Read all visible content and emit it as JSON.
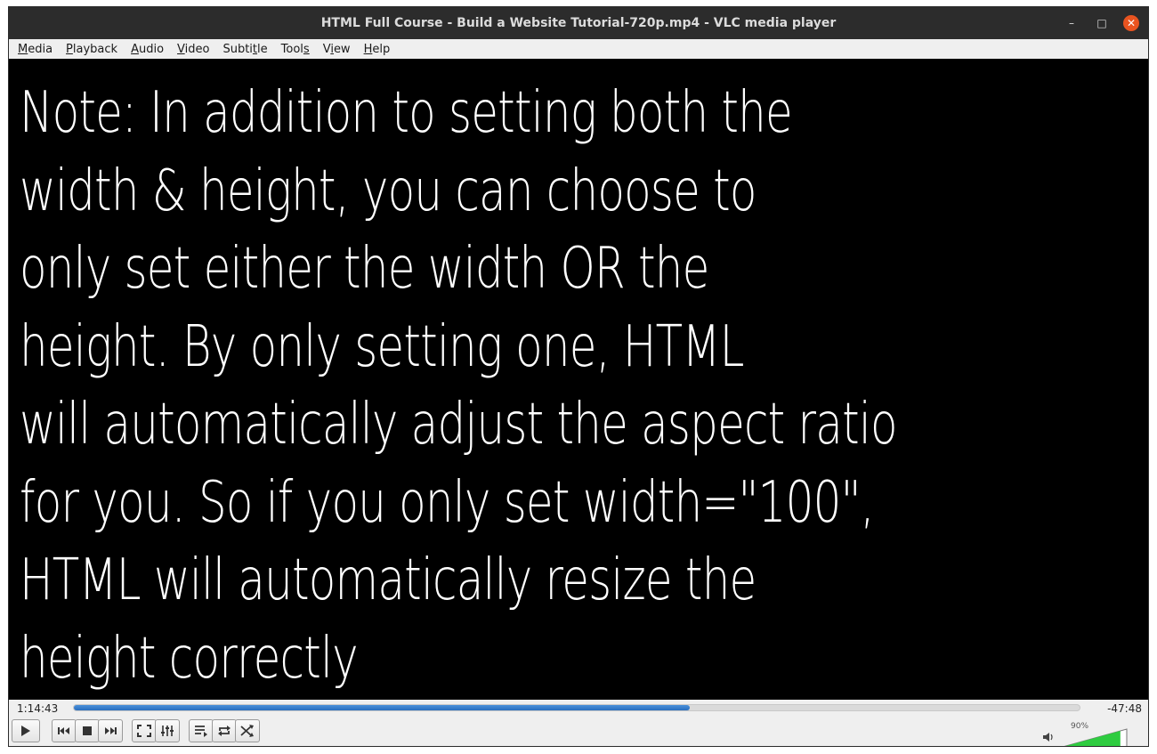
{
  "window": {
    "title": "HTML Full Course - Build a Website Tutorial-720p.mp4 - VLC media player",
    "minimize_glyph": "–",
    "maximize_glyph": "□",
    "close_glyph": "✕"
  },
  "menu": [
    {
      "u": "M",
      "rest": "edia"
    },
    {
      "u": "P",
      "rest": "layback"
    },
    {
      "u": "A",
      "rest": "udio"
    },
    {
      "u": "V",
      "rest": "ideo"
    },
    {
      "u": "",
      "pre": "Subti",
      "u2": "t",
      "rest": "le"
    },
    {
      "u": "",
      "pre": "Tool",
      "u2": "s",
      "rest": ""
    },
    {
      "u": "",
      "pre": "V",
      "u2": "i",
      "rest": "ew"
    },
    {
      "u": "H",
      "rest": "elp"
    }
  ],
  "video": {
    "lines": [
      "Note: In addition to setting both the",
      "width & height, you can choose to",
      "only set either the width OR the",
      "height. By only setting one, HTML",
      "will automatically adjust the aspect ratio",
      "for you. So if you only set width=\"100\",",
      "HTML will automatically resize the",
      "height correctly"
    ]
  },
  "playback": {
    "elapsed": "1:14:43",
    "remaining": "-47:48",
    "progress_fraction": 0.612
  },
  "volume": {
    "label": "90%",
    "level": 0.9,
    "color": "#2ecc40"
  },
  "icons": {
    "play": "play-icon",
    "prev": "previous-icon",
    "stop": "stop-icon",
    "next": "next-icon",
    "fullscreen": "fullscreen-icon",
    "ext": "extended-settings-icon",
    "playlist": "playlist-icon",
    "loop": "loop-icon",
    "shuffle": "shuffle-icon",
    "speaker": "speaker-icon"
  }
}
